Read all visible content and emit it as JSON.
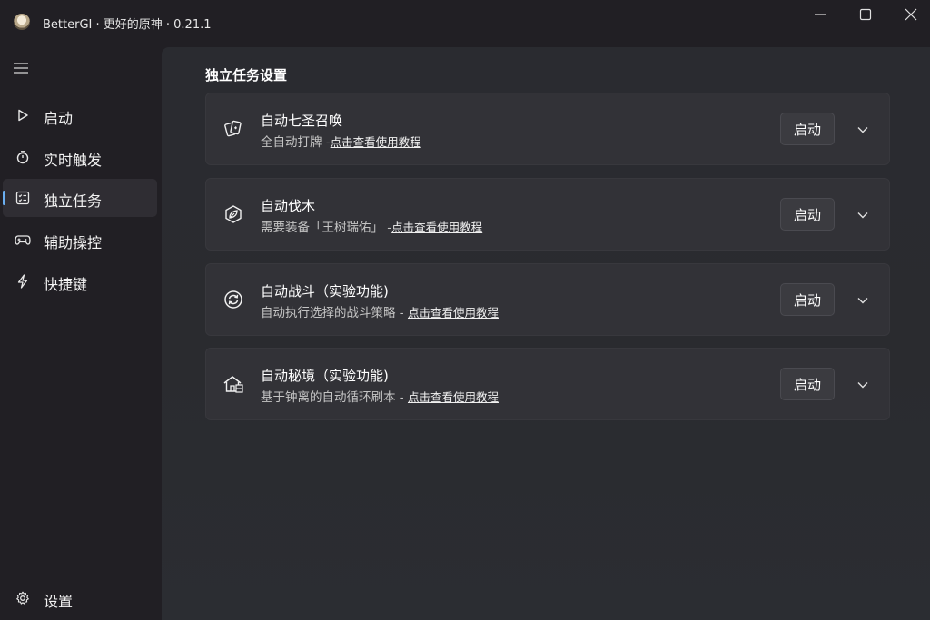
{
  "window": {
    "title": "BetterGI · 更好的原神 · 0.21.1",
    "minimize_icon": "minimize-icon",
    "maximize_icon": "maximize-icon",
    "close_icon": "close-icon"
  },
  "sidebar": {
    "menu_icon": "hamburger-icon",
    "items": [
      {
        "label": "启动",
        "icon": "play-icon",
        "active": false
      },
      {
        "label": "实时触发",
        "icon": "stopwatch-icon",
        "active": false
      },
      {
        "label": "独立任务",
        "icon": "task-list-icon",
        "active": true
      },
      {
        "label": "辅助操控",
        "icon": "gamepad-icon",
        "active": false
      },
      {
        "label": "快捷键",
        "icon": "lightning-icon",
        "active": false
      }
    ],
    "footer": {
      "label": "设置",
      "icon": "gear-icon"
    }
  },
  "main": {
    "title": "独立任务设置",
    "tasks": [
      {
        "title": "自动七圣召唤",
        "desc": "全自动打牌 -",
        "link": "点击查看使用教程",
        "button": "启动",
        "icon": "cards-icon"
      },
      {
        "title": "自动伐木",
        "desc": "需要装备「王树瑞佑」 -",
        "link": "点击查看使用教程",
        "button": "启动",
        "icon": "leaf-icon"
      },
      {
        "title": "自动战斗（实验功能)",
        "desc": "自动执行选择的战斗策略 - ",
        "link": "点击查看使用教程",
        "button": "启动",
        "icon": "refresh-icon"
      },
      {
        "title": "自动秘境（实验功能)",
        "desc": "基于钟离的自动循环刷本 - ",
        "link": "点击查看使用教程",
        "button": "启动",
        "icon": "domain-icon"
      }
    ]
  },
  "colors": {
    "accent": "#6aaef0",
    "card_bg": "#323237",
    "content_bg": "#2a2b30",
    "window_bg": "#211f24"
  }
}
